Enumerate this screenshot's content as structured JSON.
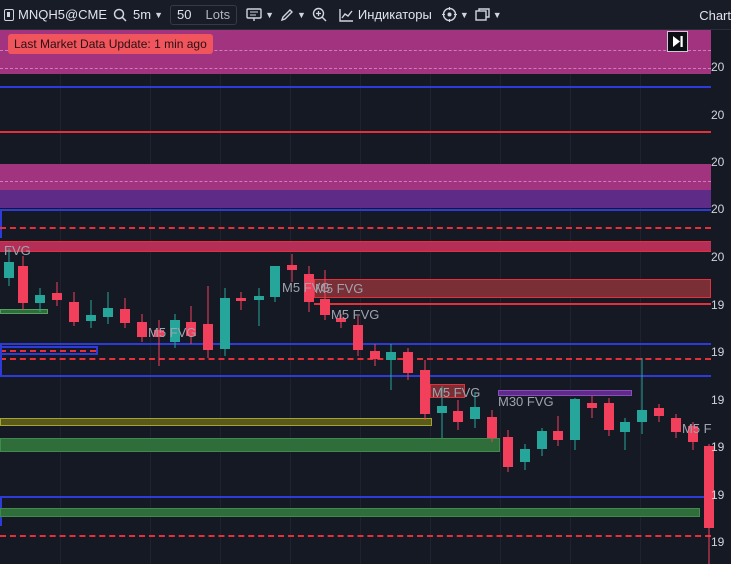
{
  "toolbar": {
    "symbol": "MNQH5@CME",
    "search_icon": "search-icon",
    "interval": "5m",
    "quantity": "50",
    "quantity_unit": "Lots",
    "alerts_icon": "alerts-icon",
    "drawing_icon": "pen-icon",
    "zoom_icon": "zoom-in-icon",
    "indicators_icon": "indicators-icon",
    "indicators_label": "Индикаторы",
    "templates_icon": "templates-icon",
    "layout_icon": "layout-icon",
    "right_label": "Chart"
  },
  "status_badge": "Last Market Data Update: 1 min ago",
  "fvg_labels": [
    "FVG",
    "M5 FVG",
    "M5 FVG",
    "M5 FVG",
    "M5 FVG",
    "M5 FVG",
    "M30 FVG",
    "M5 F"
  ],
  "price_axis_labels": [
    "20",
    "20",
    "20",
    "20",
    "20",
    "19",
    "19",
    "19",
    "19",
    "19",
    "19"
  ],
  "colors": {
    "background": "#151924",
    "bull": "#26a69a",
    "bear": "#f23f5c",
    "zone_magenta": "#a2337f",
    "zone_purple": "#5e2c86",
    "line_blue": "#2d3cd8",
    "line_red": "#e5303a",
    "zone_olive": "#5a5a1c",
    "zone_green": "#2f6d3a",
    "badge": "#f0555e"
  }
}
